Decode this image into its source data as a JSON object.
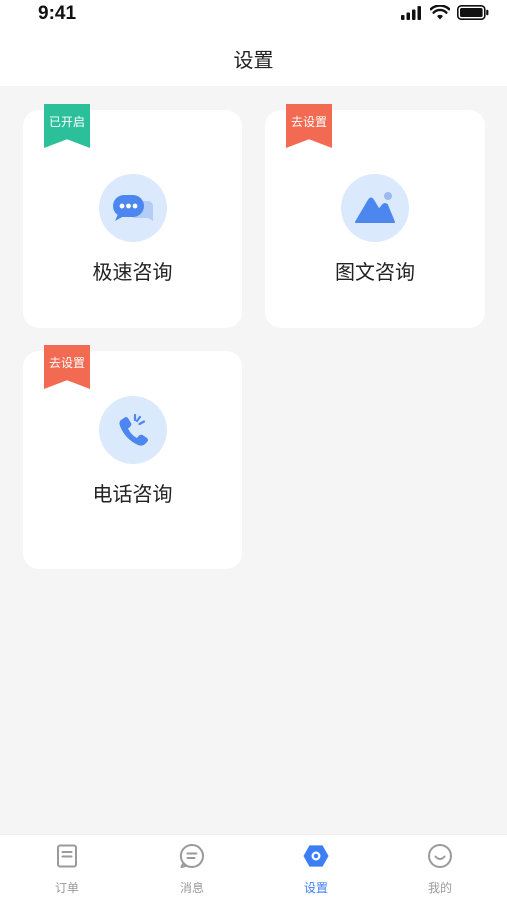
{
  "status_bar": {
    "time": "9:41"
  },
  "header": {
    "title": "设置"
  },
  "cards": [
    {
      "label": "极速咨询",
      "badge": "已开启",
      "badge_state": "enabled",
      "icon": "chat-bubble-icon"
    },
    {
      "label": "图文咨询",
      "badge": "去设置",
      "badge_state": "not-set",
      "icon": "image-icon"
    },
    {
      "label": "电话咨询",
      "badge": "去设置",
      "badge_state": "not-set",
      "icon": "phone-icon"
    }
  ],
  "tabbar": {
    "items": [
      {
        "label": "订单",
        "icon": "order-icon",
        "active": false
      },
      {
        "label": "消息",
        "icon": "message-icon",
        "active": false
      },
      {
        "label": "设置",
        "icon": "settings-icon",
        "active": true
      },
      {
        "label": "我的",
        "icon": "profile-icon",
        "active": false
      }
    ]
  },
  "colors": {
    "accent": "#3d7ef5",
    "badge_enabled": "#2bbf9a",
    "badge_not_set": "#f36a52",
    "icon_bg": "#dbe9fd",
    "background": "#f5f5f5"
  }
}
